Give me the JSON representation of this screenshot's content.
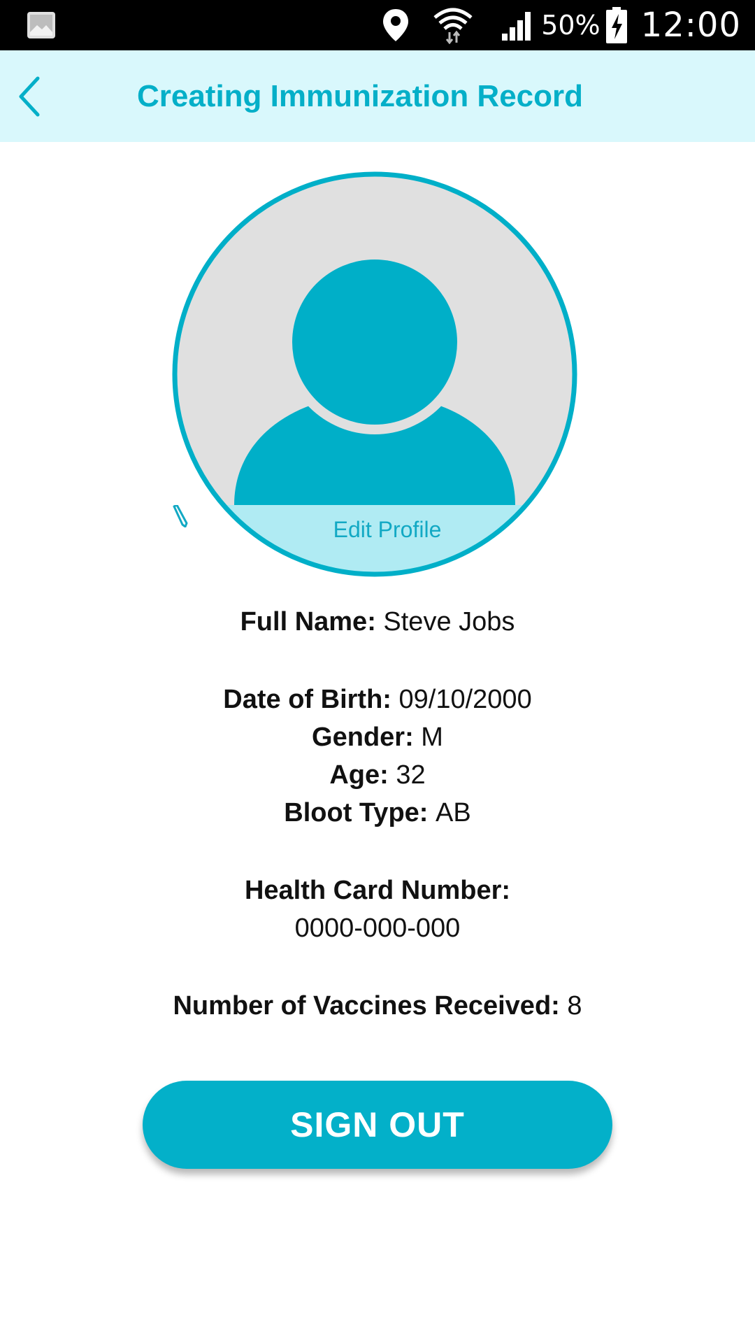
{
  "status_bar": {
    "battery_percent": "50%",
    "time": "12:00",
    "icons": [
      "gallery-icon",
      "location-icon",
      "wifi-icon",
      "signal-icon",
      "battery-charging-icon"
    ]
  },
  "header": {
    "title": "Creating Immunization Record",
    "back_icon": "chevron-left-icon",
    "background": "#d9f8fc",
    "accent": "#04afc8"
  },
  "profile": {
    "avatar_icon": "user-avatar-icon",
    "edit_label": "Edit Profile",
    "edit_icon": "pencil-icon"
  },
  "info": {
    "full_name_label": "Full Name:",
    "full_name_value": "Steve Jobs",
    "dob_label": "Date of Birth:",
    "dob_value": "09/10/2000",
    "gender_label": "Gender:",
    "gender_value": "M",
    "age_label": "Age:",
    "age_value": "32",
    "blood_type_label": "Bloot Type:",
    "blood_type_value": "AB",
    "health_card_label": "Health Card Number:",
    "health_card_value": "0000-000-000",
    "vaccines_label": "Number of Vaccines Received:",
    "vaccines_value": "8"
  },
  "actions": {
    "sign_out_label": "SIGN OUT",
    "button_color": "#03b0c9"
  }
}
